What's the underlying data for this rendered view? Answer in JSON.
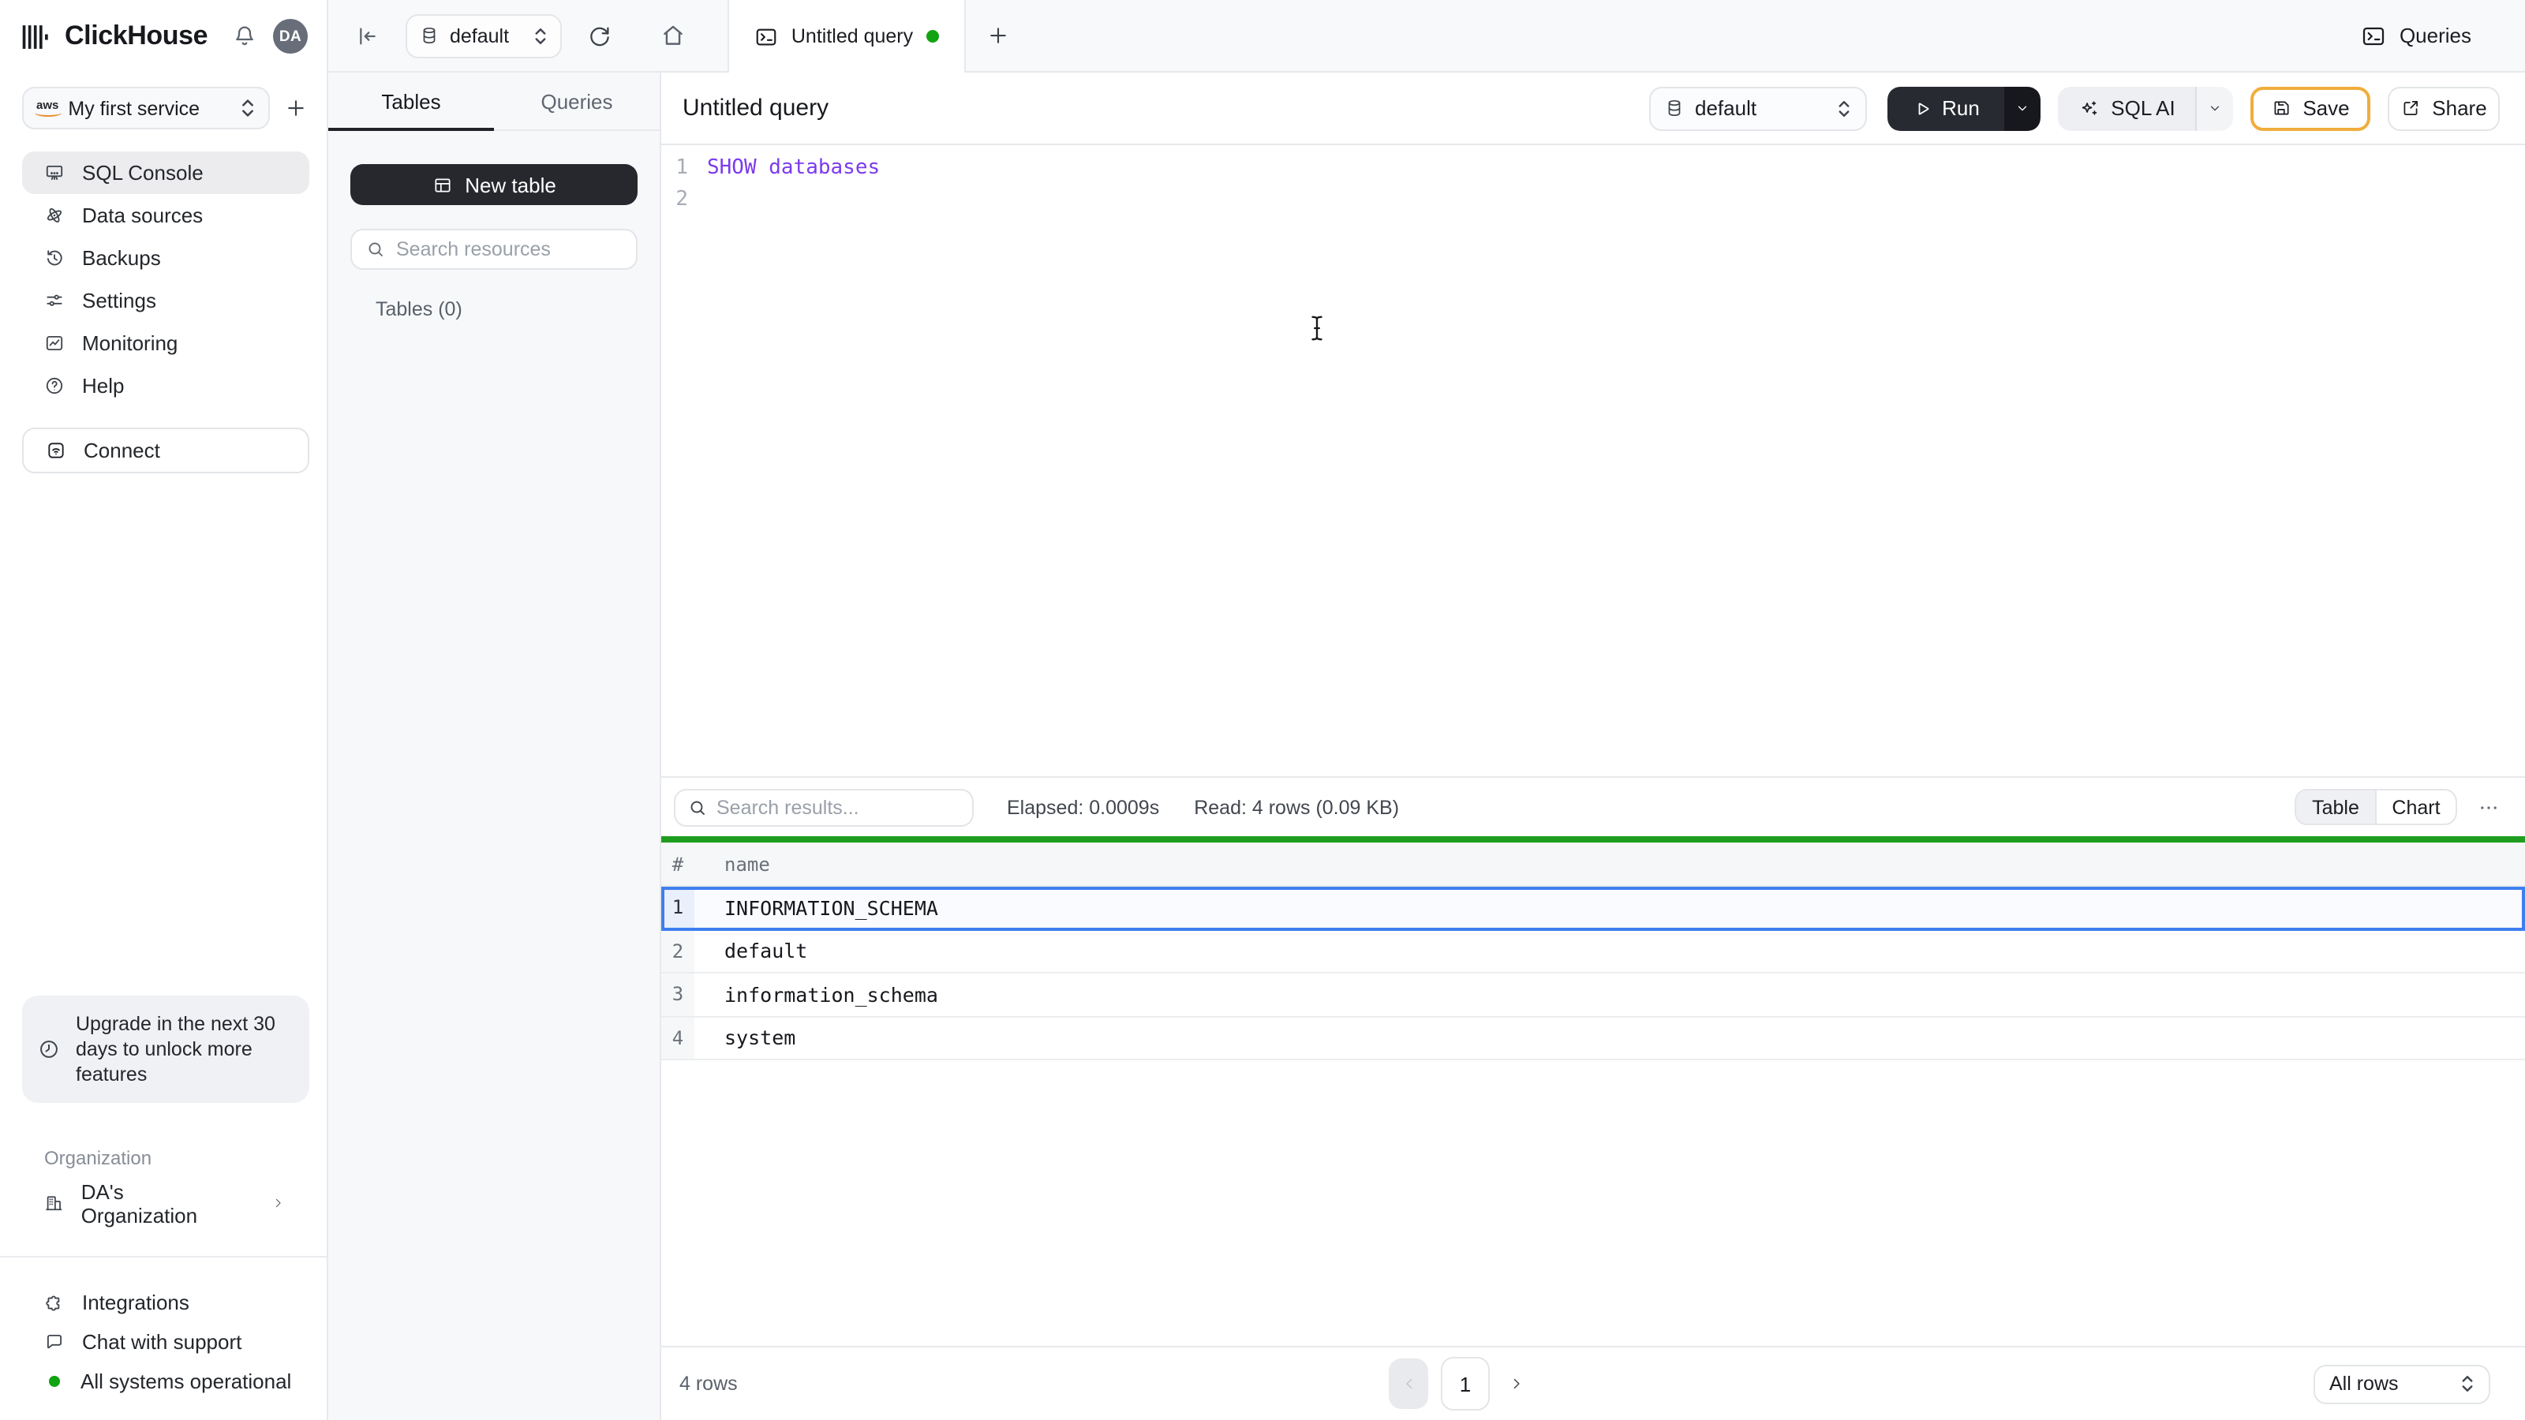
{
  "brand": {
    "name": "ClickHouse",
    "avatar_initials": "DA"
  },
  "topbar": {
    "queries_label": "Queries"
  },
  "tabstrip": {
    "database": "default",
    "tab_title": "Untitled query"
  },
  "sidebar": {
    "service_name": "My first service",
    "nav_items": [
      {
        "label": "SQL Console"
      },
      {
        "label": "Data sources"
      },
      {
        "label": "Backups"
      },
      {
        "label": "Settings"
      },
      {
        "label": "Monitoring"
      },
      {
        "label": "Help"
      }
    ],
    "connect_label": "Connect",
    "upgrade_notice": "Upgrade in the next 30 days to unlock more features",
    "organization_label": "Organization",
    "organization_name": "DA's Organization",
    "integrations_label": "Integrations",
    "chat_label": "Chat with support",
    "status_label": "All systems operational"
  },
  "explorer": {
    "tab_tables": "Tables",
    "tab_queries": "Queries",
    "new_table_label": "New table",
    "search_placeholder": "Search resources",
    "tables_count": "Tables (0)"
  },
  "editor": {
    "title": "Untitled query",
    "database": "default",
    "run_label": "Run",
    "sql_ai_label": "SQL AI",
    "save_label": "Save",
    "share_label": "Share",
    "lines": [
      {
        "number": "1",
        "code": "SHOW databases"
      },
      {
        "number": "2",
        "code": ""
      }
    ]
  },
  "results": {
    "search_placeholder": "Search results...",
    "elapsed": "Elapsed: 0.0009s",
    "read": "Read: 4 rows (0.09 KB)",
    "view_table": "Table",
    "view_chart": "Chart",
    "columns": {
      "index": "#",
      "name": "name"
    },
    "rows": [
      {
        "num": "1",
        "name": "INFORMATION_SCHEMA"
      },
      {
        "num": "2",
        "name": "default"
      },
      {
        "num": "3",
        "name": "information_schema"
      },
      {
        "num": "4",
        "name": "system"
      }
    ],
    "footer": {
      "row_count": "4 rows",
      "page": "1",
      "page_size": "All rows"
    }
  },
  "colors": {
    "accent_green": "#12a312",
    "success_bar": "#1f9d1f",
    "selection_blue": "#3e7ff0",
    "sql_keyword": "#7c3bed",
    "save_border": "#f0ad3d"
  }
}
